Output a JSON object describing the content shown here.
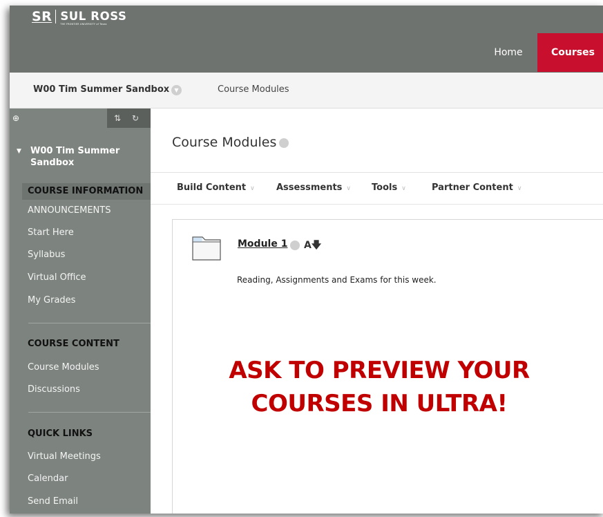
{
  "header": {
    "logo_sr": "SR",
    "logo_name": "SUL ROSS",
    "logo_tagline": "THE FRONTIER UNIVERSITY of Texas",
    "nav": [
      {
        "label": "Home"
      },
      {
        "label": "Courses"
      }
    ],
    "accent_color": "#c8102e",
    "bar_color": "#6e736f"
  },
  "breadcrumb": {
    "course": "W00 Tim Summer Sandbox",
    "current": "Course Modules"
  },
  "sidebar": {
    "tools": {
      "add": "⊕",
      "sort": "⇅",
      "refresh": "↻"
    },
    "course": "W00 Tim Summer Sandbox",
    "sections": [
      {
        "header": "COURSE INFORMATION",
        "items": [
          "ANNOUNCEMENTS",
          "Start Here",
          "Syllabus",
          "Virtual Office",
          "My Grades"
        ]
      },
      {
        "header": "COURSE CONTENT",
        "items": [
          "Course Modules",
          "Discussions"
        ]
      },
      {
        "header": "QUICK LINKS",
        "items": [
          "Virtual Meetings",
          "Calendar",
          "Send Email"
        ]
      }
    ]
  },
  "page": {
    "title": "Course Modules"
  },
  "toolbar": {
    "items": [
      "Build Content",
      "Assessments",
      "Tools",
      "Partner Content"
    ]
  },
  "module": {
    "title": "Module 1",
    "icon_text": "A",
    "description": "Reading, Assignments and Exams for this week."
  },
  "overlay": {
    "line1": "ASK TO PREVIEW YOUR",
    "line2": "COURSES IN ULTRA!",
    "color": "#c00000"
  }
}
